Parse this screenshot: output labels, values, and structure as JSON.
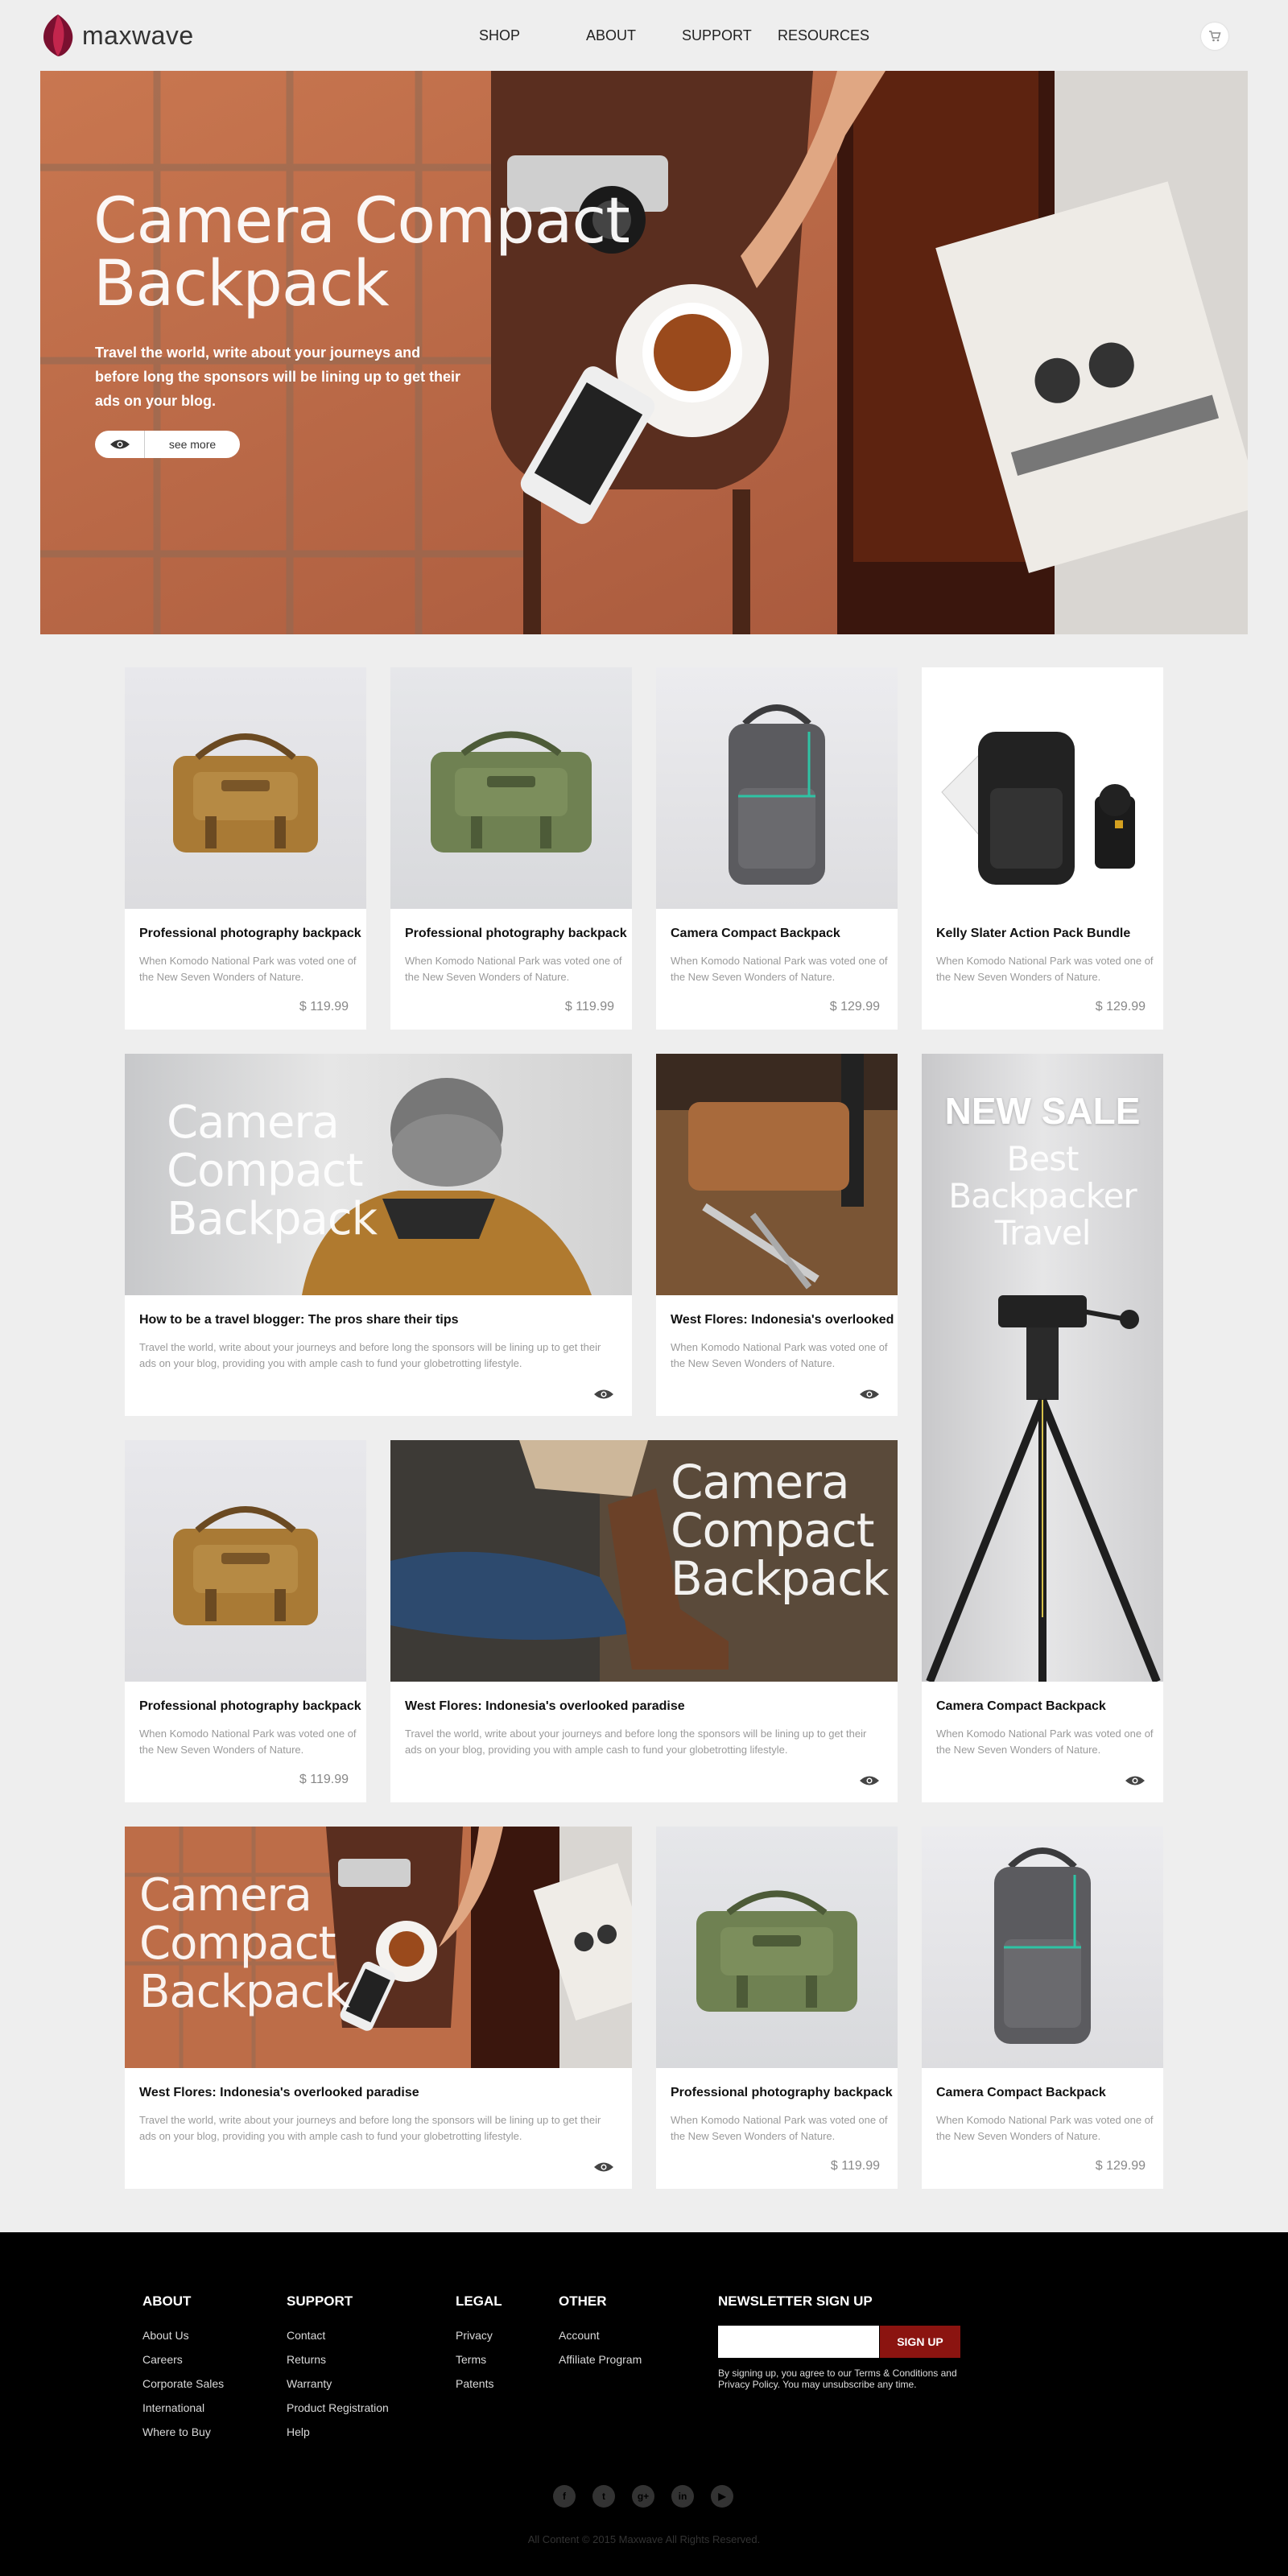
{
  "brand": {
    "name": "maxwave",
    "accent": "#9b1c3a"
  },
  "nav": [
    "SHOP",
    "ABOUT",
    "SUPPORT",
    "RESOURCES"
  ],
  "hero": {
    "title": "Camera Compact Backpack",
    "text": "Travel the world, write about your journeys and before long the sponsors will be lining up to get their ads on your blog.",
    "button": "see more"
  },
  "products": [
    {
      "title": "Professional photography backpack",
      "desc": "When Komodo National Park was voted one of the New Seven Wonders of Nature.",
      "price": "$ 119.99"
    },
    {
      "title": "Professional photography backpack",
      "desc": "When Komodo National Park was voted one of the New Seven Wonders of Nature.",
      "price": "$ 119.99"
    },
    {
      "title": "Camera Compact Backpack",
      "desc": "When Komodo National Park was voted one of the New Seven Wonders of Nature.",
      "price": "$ 129.99"
    },
    {
      "title": "Kelly Slater Action Pack Bundle",
      "desc": "When Komodo National Park was voted one of the New Seven Wonders of Nature.",
      "price": "$ 129.99"
    }
  ],
  "row2": {
    "blog1": {
      "overlay": "Camera Compact Backpack",
      "title": "How to be a travel blogger: The pros share their tips",
      "desc": "Travel the world, write about your journeys and before long the sponsors will be lining up to get their ads on your blog, providing you with ample cash to fund your globetrotting lifestyle."
    },
    "blog2": {
      "title": "West Flores: Indonesia's overlooked",
      "desc": "When Komodo National Park was voted one of the New Seven Wonders of Nature."
    },
    "sale": {
      "headline": "NEW SALE",
      "sub": "Best Backpacker Travel",
      "title": "Camera Compact Backpack",
      "desc": "When Komodo National Park was voted one of the New Seven Wonders of Nature."
    }
  },
  "row3": {
    "product": {
      "title": "Professional photography backpack",
      "desc": "When Komodo National Park was voted one of the New Seven Wonders of Nature.",
      "price": "$ 119.99"
    },
    "blog": {
      "overlay": "Camera Compact Backpack",
      "title": "West Flores: Indonesia's overlooked paradise",
      "desc": "Travel the world, write about your journeys and before long the sponsors will be lining up to get their ads on your blog, providing you with ample cash to fund your globetrotting lifestyle."
    }
  },
  "row4": {
    "blog": {
      "overlay": "Camera Compact Backpack",
      "title": "West Flores: Indonesia's overlooked paradise",
      "desc": "Travel the world, write about your journeys and before long the sponsors will be lining up to get their ads on your blog, providing you with ample cash to fund your globetrotting lifestyle."
    },
    "p1": {
      "title": "Professional photography backpack",
      "desc": "When Komodo National Park was voted one of the New Seven Wonders of Nature.",
      "price": "$ 119.99"
    },
    "p2": {
      "title": "Camera Compact Backpack",
      "desc": "When Komodo National Park was voted one of the New Seven Wonders of Nature.",
      "price": "$ 129.99"
    }
  },
  "footer": {
    "about": {
      "title": "ABOUT",
      "links": [
        "About Us",
        "Careers",
        "Corporate Sales",
        "International",
        "Where to Buy"
      ]
    },
    "support": {
      "title": "SUPPORT",
      "links": [
        "Contact",
        "Returns",
        "Warranty",
        "Product Registration",
        "Help"
      ]
    },
    "legal": {
      "title": "LEGAL",
      "links": [
        "Privacy",
        "Terms",
        "Patents"
      ]
    },
    "other": {
      "title": "OTHER",
      "links": [
        "Account",
        "Affiliate Program"
      ]
    },
    "newsletter": {
      "title": "NEWSLETTER SIGN UP",
      "button": "SIGN UP",
      "note": "By signing up, you agree to our Terms & Conditions and Privacy Policy. You may unsubscribe any time."
    },
    "social": [
      "facebook-icon",
      "twitter-icon",
      "google-plus-icon",
      "linkedin-icon",
      "youtube-icon"
    ],
    "copyright": "All Content © 2015 Maxwave All Rights Reserved."
  }
}
